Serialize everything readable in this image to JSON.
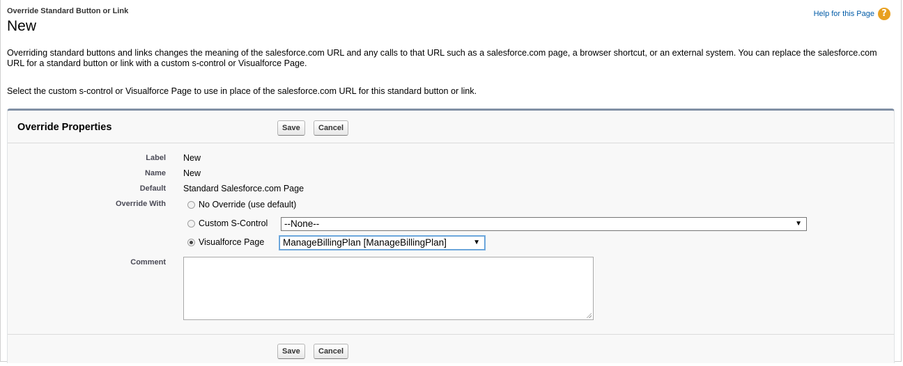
{
  "header": {
    "page_type": "Override Standard Button or Link",
    "title": "New",
    "help_link": "Help for this Page",
    "help_icon": "?"
  },
  "description": {
    "paragraph1": "Overriding standard buttons and links changes the meaning of the salesforce.com URL and any calls to that URL such as a salesforce.com page, a browser shortcut, or an external system. You can replace the salesforce.com URL for a standard button or link with a custom s-control or Visualforce Page.",
    "paragraph2": "Select the custom s-control or Visualforce Page to use in place of the salesforce.com URL for this standard button or link."
  },
  "section": {
    "title": "Override Properties",
    "save_label": "Save",
    "cancel_label": "Cancel"
  },
  "fields": {
    "label": {
      "label": "Label",
      "value": "New"
    },
    "name": {
      "label": "Name",
      "value": "New"
    },
    "default": {
      "label": "Default",
      "value": "Standard Salesforce.com Page"
    },
    "override_with": {
      "label": "Override With",
      "options": [
        {
          "label": "No Override (use default)",
          "checked": false
        },
        {
          "label": "Custom S-Control",
          "checked": false,
          "select_value": "--None--"
        },
        {
          "label": "Visualforce Page",
          "checked": true,
          "select_value": "ManageBillingPlan [ManageBillingPlan]"
        }
      ]
    },
    "comment": {
      "label": "Comment",
      "value": ""
    }
  },
  "colors": {
    "accent_border": "#8190a5",
    "help_link": "#015ba7",
    "help_icon": "#e8a020"
  }
}
